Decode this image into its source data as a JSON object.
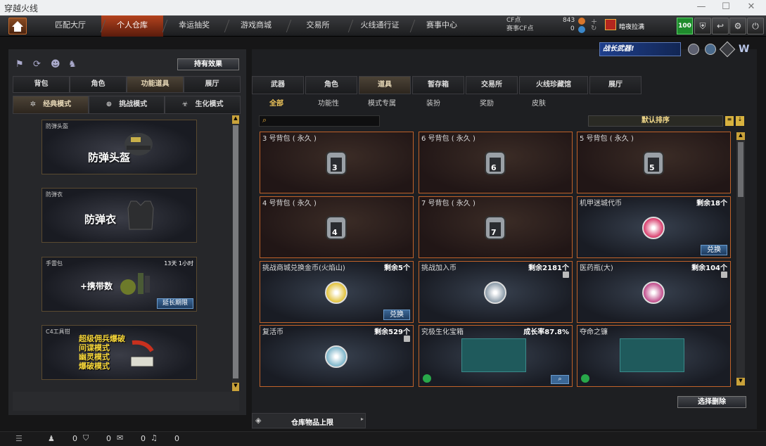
{
  "window": {
    "title": "穿越火线"
  },
  "nav": {
    "tabs": [
      "匹配大厅",
      "个人仓库",
      "幸运抽奖",
      "游戏商城",
      "交易所",
      "火线通行证",
      "赛事中心"
    ],
    "active": 1
  },
  "currency": {
    "cf_label": "CF点",
    "cf_value": "843",
    "match_cf_label": "赛事CF点",
    "match_cf_value": "0",
    "user": "暗夜拉满",
    "level": "100"
  },
  "left": {
    "effect_button": "持有效果",
    "tabs": [
      "背包",
      "角色",
      "功能道具",
      "展厅"
    ],
    "active_tab": 2,
    "modes": [
      "经典模式",
      "挑战模式",
      "生化模式"
    ],
    "active_mode": 0,
    "slots": [
      {
        "label": "防弹头盔",
        "title": "防弹头盔"
      },
      {
        "label": "防弹衣",
        "title": "防弹衣"
      },
      {
        "label": "手雷包",
        "title": "+携带数",
        "time": "13天 1小时",
        "action": "延长期限"
      },
      {
        "label": "C4工具钳",
        "lines": [
          "超级佣兵爆破",
          "间谍模式",
          "幽灵模式",
          "爆破模式"
        ]
      }
    ]
  },
  "banner": {
    "text": "战长武器!"
  },
  "right": {
    "tabs": [
      "武器",
      "角色",
      "道具",
      "暂存箱",
      "交易所",
      "火线珍藏馆",
      "展厅"
    ],
    "active_tab": 2,
    "subtabs": [
      "全部",
      "功能性",
      "模式专属",
      "装扮",
      "奖励",
      "皮肤"
    ],
    "active_subtab": 0,
    "sort_label": "默认排序",
    "items": [
      {
        "name": "3 号背包 ( 永久 )",
        "bag": "3",
        "type": "bag"
      },
      {
        "name": "6 号背包 ( 永久 )",
        "bag": "6",
        "type": "bag"
      },
      {
        "name": "5 号背包 ( 永久 )",
        "bag": "5",
        "type": "bag"
      },
      {
        "name": "4 号背包 ( 永久 )",
        "bag": "4",
        "type": "bag"
      },
      {
        "name": "7 号背包 ( 永久 )",
        "bag": "7",
        "type": "bag"
      },
      {
        "name": "机甲迷城代币",
        "remain": "剩余18个",
        "action": "兑换",
        "type": "token"
      },
      {
        "name": "挑战商城兑换金币(火焰山)",
        "remain": "剩余5个",
        "action": "兑换",
        "type": "coin"
      },
      {
        "name": "挑战加入币",
        "remain": "剩余2181个",
        "type": "join"
      },
      {
        "name": "医药瓶(大)",
        "remain": "剩余104个",
        "type": "med"
      },
      {
        "name": "复活币",
        "remain": "剩余529个",
        "type": "revive"
      },
      {
        "name": "究极生化宝箱",
        "remain": "成长率87.8%",
        "type": "box"
      },
      {
        "name": "夺命之镰",
        "type": "scythe"
      }
    ],
    "bulk_delete": "选择删除",
    "warehouse_limit": "仓库物品上限"
  },
  "statusbar": {
    "a": "0",
    "b": "0",
    "c": "0",
    "d": "0"
  }
}
